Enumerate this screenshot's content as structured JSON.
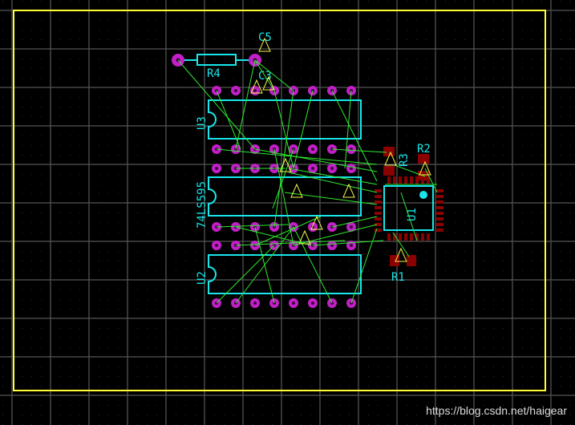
{
  "colors": {
    "background": "#000000",
    "board_outline": "#ffff33",
    "silkscreen": "#19e6ea",
    "pad": "#c21fc8",
    "ratsnest": "#2eea2e",
    "smd_pad": "#8b0000"
  },
  "components": {
    "C5": "C5",
    "C3": "C3",
    "R4": "R4",
    "U3": "U3",
    "U2_74LS595": "74LS595",
    "U2": "U2",
    "U1": "U1",
    "R3": "R3",
    "R2": "R2",
    "R1": "R1"
  },
  "watermark": "https://blog.csdn.net/haigear"
}
